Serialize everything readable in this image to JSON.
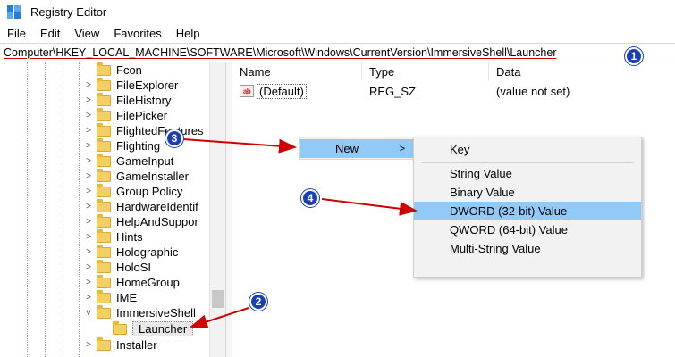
{
  "window": {
    "title": "Registry Editor",
    "app_icon": "registry-icon"
  },
  "menubar": {
    "items": [
      "File",
      "Edit",
      "View",
      "Favorites",
      "Help"
    ]
  },
  "addressbar": {
    "path": "Computer\\HKEY_LOCAL_MACHINE\\SOFTWARE\\Microsoft\\Windows\\CurrentVersion\\ImmersiveShell\\Launcher"
  },
  "tree": {
    "items": [
      {
        "label": "Fcon",
        "expander": ""
      },
      {
        "label": "FileExplorer",
        "expander": ">"
      },
      {
        "label": "FileHistory",
        "expander": ">"
      },
      {
        "label": "FilePicker",
        "expander": ">"
      },
      {
        "label": "FlightedFeatures",
        "expander": ">"
      },
      {
        "label": "Flighting",
        "expander": ">"
      },
      {
        "label": "GameInput",
        "expander": ">"
      },
      {
        "label": "GameInstaller",
        "expander": ">"
      },
      {
        "label": "Group Policy",
        "expander": ">"
      },
      {
        "label": "HardwareIdentif",
        "expander": ">"
      },
      {
        "label": "HelpAndSuppor",
        "expander": ">"
      },
      {
        "label": "Hints",
        "expander": ">"
      },
      {
        "label": "Holographic",
        "expander": ">"
      },
      {
        "label": "HoloSI",
        "expander": ">"
      },
      {
        "label": "HomeGroup",
        "expander": ">"
      },
      {
        "label": "IME",
        "expander": ">"
      },
      {
        "label": "ImmersiveShell",
        "expander": "v"
      },
      {
        "label": "Launcher",
        "expander": ""
      },
      {
        "label": "Installer",
        "expander": ">"
      }
    ]
  },
  "listview": {
    "columns": {
      "name": "Name",
      "type": "Type",
      "data": "Data"
    },
    "rows": [
      {
        "name": "(Default)",
        "type": "REG_SZ",
        "data": "(value not set)",
        "icon_text": "ab"
      }
    ]
  },
  "context_menu": {
    "new_label": "New",
    "arrow": ">"
  },
  "submenu": {
    "items": [
      "Key",
      "String Value",
      "Binary Value",
      "DWORD (32-bit) Value",
      "QWORD (64-bit) Value",
      "Multi-String Value"
    ]
  },
  "badges": [
    "1",
    "2",
    "3",
    "4"
  ],
  "colors": {
    "highlight": "#91c9f7",
    "badge": "#1a3fb0",
    "arrow": "#d00000"
  }
}
